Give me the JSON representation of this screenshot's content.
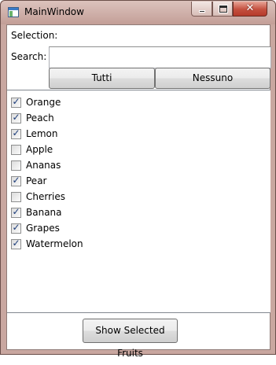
{
  "window": {
    "title": "MainWindow",
    "accent": "#c4503f",
    "icons": {
      "minimize": "minimize-icon",
      "maximize": "maximize-icon",
      "close": "close-icon"
    }
  },
  "form": {
    "selection_label": "Selection:",
    "selection_value": "",
    "search_label": "Search:",
    "search_value": "",
    "all_button": "Tutti",
    "none_button": "Nessuno"
  },
  "fruits": [
    {
      "label": "Orange",
      "checked": true
    },
    {
      "label": "Peach",
      "checked": true
    },
    {
      "label": "Lemon",
      "checked": true
    },
    {
      "label": "Apple",
      "checked": false
    },
    {
      "label": "Ananas",
      "checked": false
    },
    {
      "label": "Pear",
      "checked": true
    },
    {
      "label": "Cherries",
      "checked": false
    },
    {
      "label": "Banana",
      "checked": true
    },
    {
      "label": "Grapes",
      "checked": true
    },
    {
      "label": "Watermelon",
      "checked": true
    }
  ],
  "footer": {
    "show_button": "Show Selected Fruits"
  }
}
